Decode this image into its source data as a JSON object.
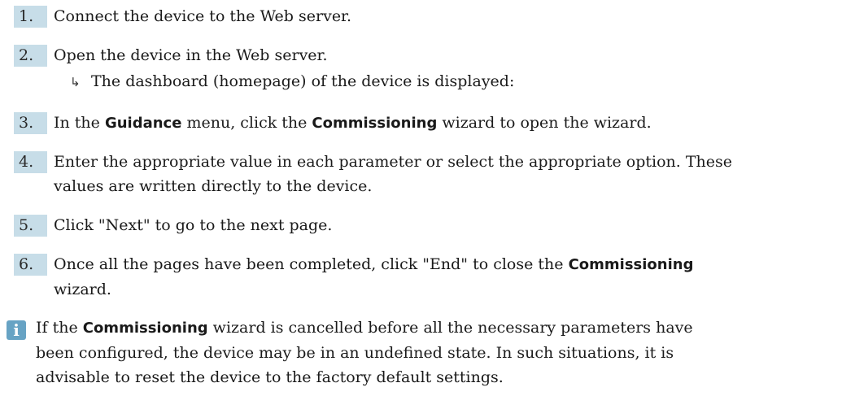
{
  "steps": [
    {
      "number": "1.",
      "lines": [
        [
          {
            "t": "Connect the device to the Web server.",
            "b": false
          }
        ]
      ]
    },
    {
      "number": "2.",
      "lines": [
        [
          {
            "t": "Open the device in the Web server.",
            "b": false
          }
        ]
      ],
      "result": "The dashboard (homepage) of the device is displayed:"
    },
    {
      "number": "3.",
      "lines": [
        [
          {
            "t": "In the ",
            "b": false
          },
          {
            "t": "Guidance",
            "b": true
          },
          {
            "t": " menu, click the ",
            "b": false
          },
          {
            "t": "Commissioning",
            "b": true
          },
          {
            "t": " wizard to open the wizard.",
            "b": false
          }
        ]
      ]
    },
    {
      "number": "4.",
      "lines": [
        [
          {
            "t": "Enter the appropriate value in each parameter or select the appropriate option. These",
            "b": false
          }
        ],
        [
          {
            "t": "values are written directly to the device.",
            "b": false
          }
        ]
      ]
    },
    {
      "number": "5.",
      "lines": [
        [
          {
            "t": "Click \"Next\" to go to the next page.",
            "b": false
          }
        ]
      ]
    },
    {
      "number": "6.",
      "lines": [
        [
          {
            "t": "Once all the pages have been completed, click \"End\" to close the ",
            "b": false
          },
          {
            "t": "Commissioning",
            "b": true
          }
        ],
        [
          {
            "t": "wizard.",
            "b": false
          }
        ]
      ]
    }
  ],
  "note": {
    "icon": "info-icon",
    "icon_glyph": "i",
    "lines": [
      [
        {
          "t": "If the ",
          "b": false
        },
        {
          "t": "Commissioning",
          "b": true
        },
        {
          "t": " wizard is cancelled before all the necessary parameters have",
          "b": false
        }
      ],
      [
        {
          "t": "been configured, the device may be in an undefined state. In such situations, it is",
          "b": false
        }
      ],
      [
        {
          "t": "advisable to reset the device to the factory default settings.",
          "b": false
        }
      ]
    ]
  },
  "colors": {
    "number_bg": "#c7dde8",
    "note_icon_bg": "#67a3c4"
  }
}
